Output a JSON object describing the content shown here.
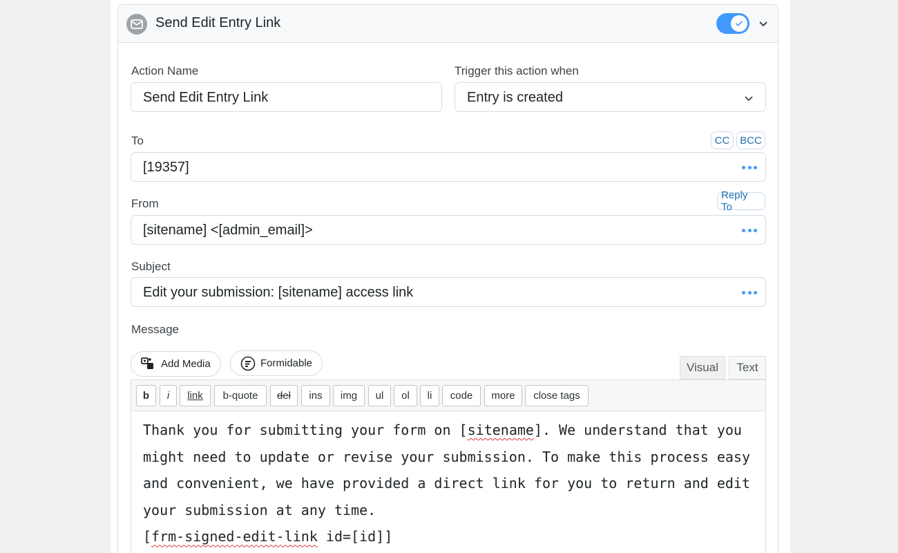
{
  "header": {
    "title": "Send Edit Entry Link",
    "toggle_on": true
  },
  "action_name": {
    "label": "Action Name",
    "value": "Send Edit Entry Link"
  },
  "trigger": {
    "label": "Trigger this action when",
    "value": "Entry is created"
  },
  "to": {
    "label": "To",
    "value": "[19357]",
    "cc_label": "CC",
    "bcc_label": "BCC"
  },
  "from": {
    "label": "From",
    "value": "[sitename] <[admin_email]>",
    "reply_to_label": "Reply To"
  },
  "subject": {
    "label": "Subject",
    "value": "Edit your submission: [sitename] access link"
  },
  "message": {
    "label": "Message",
    "add_media_label": "Add Media",
    "formidable_label": "Formidable",
    "tabs": [
      "Visual",
      "Text"
    ],
    "active_tab": "Visual",
    "toolbar": [
      "b",
      "i",
      "link",
      "b-quote",
      "del",
      "ins",
      "img",
      "ul",
      "ol",
      "li",
      "code",
      "more",
      "close tags"
    ],
    "lines": {
      "l1_pre": "Thank you for submitting your form on [",
      "l1_spell": "sitename",
      "l1_post": "]. We understand that you",
      "l2": "might need to update or revise your submission. To make this process easy",
      "l3": "and convenient, we have provided a direct link for you to return and edit",
      "l4": "your submission at any time.",
      "l5_pre": "[",
      "l5_spell": "frm-signed-edit-link",
      "l5_post": " id=[id]]"
    }
  },
  "colors": {
    "accent": "#4199fd",
    "link_blue": "#2271b1",
    "icon_gray": "#9ea3a8"
  }
}
